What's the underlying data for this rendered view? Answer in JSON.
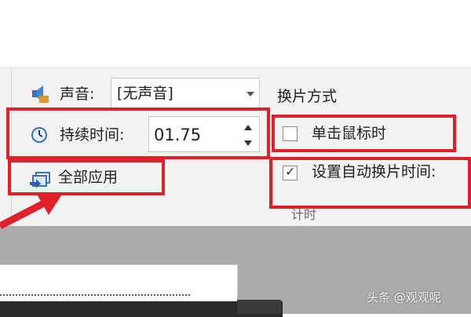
{
  "sound": {
    "label": "声音:",
    "value": "[无声音]"
  },
  "duration": {
    "label": "持续时间:",
    "value": "01.75"
  },
  "apply_all": {
    "label": "全部应用"
  },
  "advance": {
    "title": "换片方式",
    "on_click": {
      "label": "单击鼠标时",
      "checked": false
    },
    "after_time": {
      "label": "设置自动换片时间:",
      "checked": true
    }
  },
  "group_label": "计时",
  "watermark": "头条 @观观呢",
  "colors": {
    "highlight": "#e0212b",
    "ribbon_bg": "#f3f3f3",
    "workspace": "#ababab"
  }
}
